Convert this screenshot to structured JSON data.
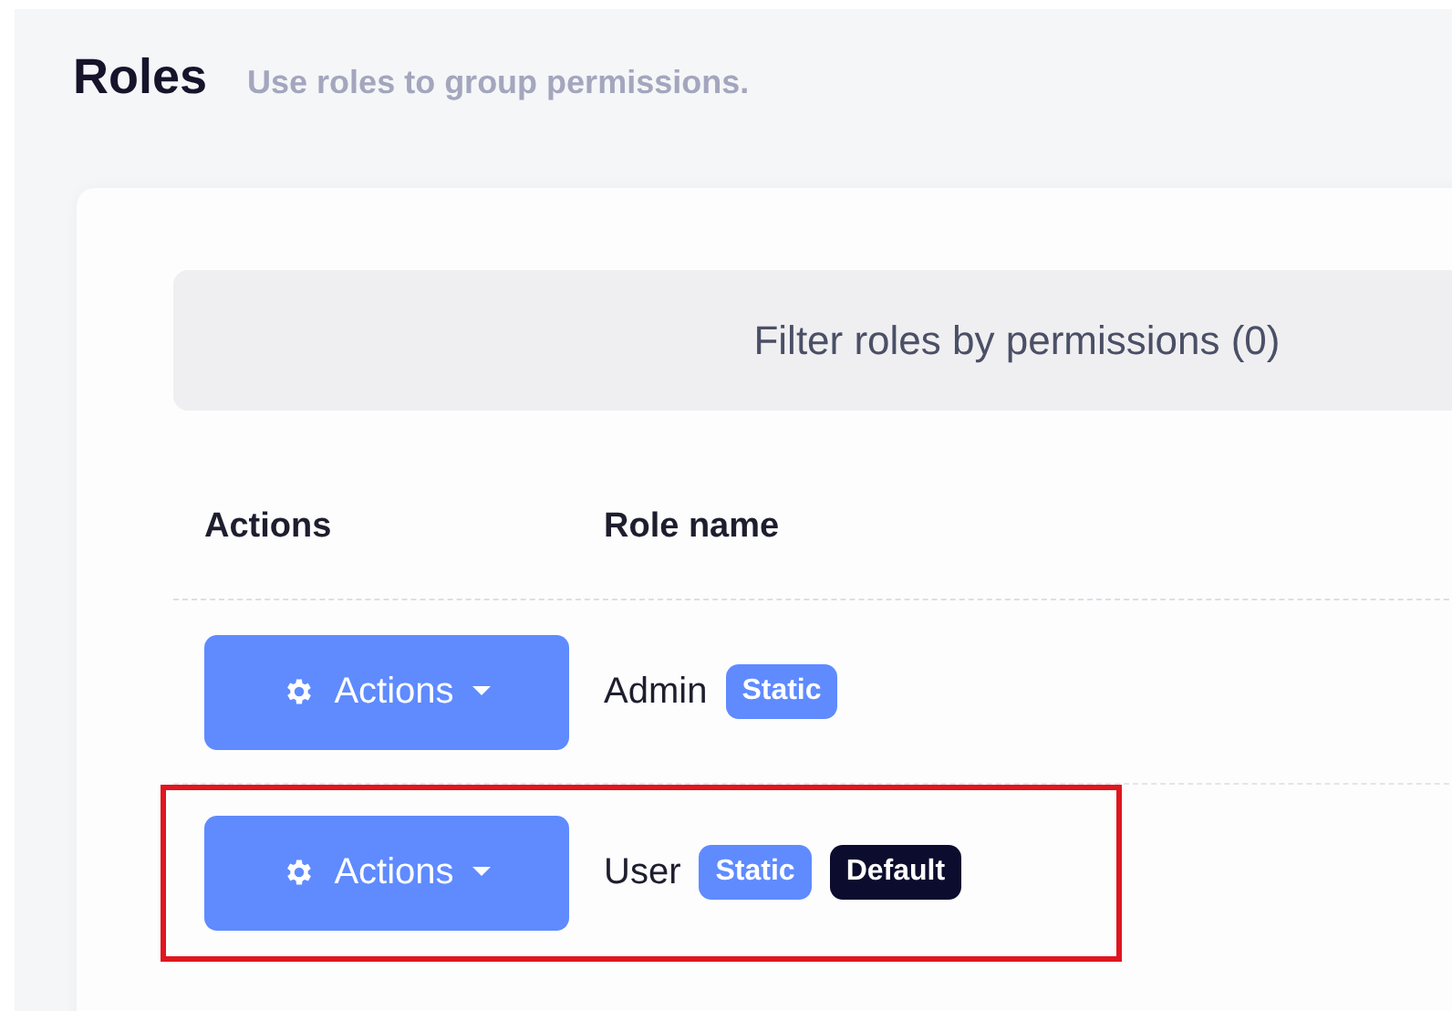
{
  "header": {
    "title": "Roles",
    "subtitle": "Use roles to group permissions."
  },
  "filter": {
    "label": "Filter roles by permissions (0)"
  },
  "table": {
    "columns": [
      "Actions",
      "Role name"
    ],
    "rows": [
      {
        "action": "Actions",
        "name": "Admin",
        "highlighted": false,
        "badges": [
          {
            "kind": "static",
            "label": "Static"
          }
        ]
      },
      {
        "action": "Actions",
        "name": "User",
        "highlighted": true,
        "badges": [
          {
            "kind": "static",
            "label": "Static"
          },
          {
            "kind": "default",
            "label": "Default"
          }
        ]
      }
    ]
  }
}
